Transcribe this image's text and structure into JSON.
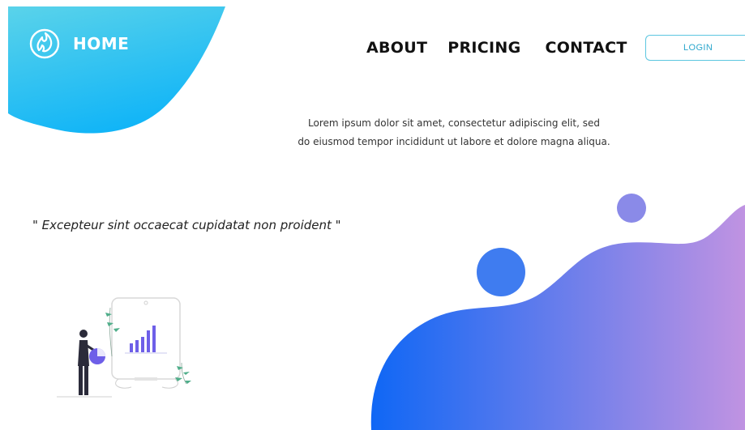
{
  "brand": {
    "label": "HOME",
    "logo_icon": "flame-logo-icon"
  },
  "nav": {
    "items": [
      {
        "label": "ABOUT"
      },
      {
        "label": "PRICING"
      },
      {
        "label": "CONTACT"
      }
    ]
  },
  "login": {
    "label": "LOGIN"
  },
  "intro": {
    "line1": "Lorem ipsum dolor sit amet, consectetur adipiscing elit, sed",
    "line2": "do eiusmod tempor incididunt ut labore et dolore magna aliqua."
  },
  "quote": {
    "text": "\" Excepteur sint occaecat cupidatat non proident \""
  },
  "colors": {
    "top_blob_start": "#5ad3ea",
    "top_blob_end": "#12b5f7",
    "bottom_blob_start": "#0f67f5",
    "bottom_blob_end": "#c093e2",
    "circle_blue": "#3f7cf0",
    "circle_purple": "#8a8ae8",
    "login_border": "#5cc6e0",
    "chart_bars": "#6e5fe8",
    "plant_leaves": "#4fae8a"
  },
  "icons": {
    "illustration": "presentation-chart-illustration"
  }
}
